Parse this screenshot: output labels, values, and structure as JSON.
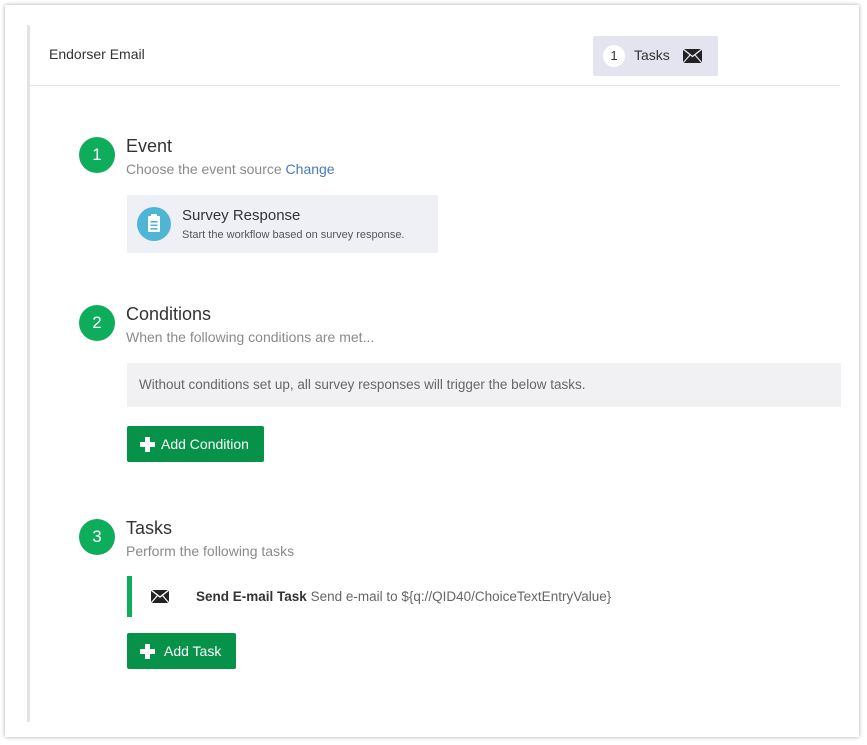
{
  "header": {
    "title": "Endorser Email",
    "tasks_count": "1",
    "tasks_label": "Tasks",
    "tasks_icon": "envelope-icon"
  },
  "steps": [
    {
      "number": "1",
      "title": "Event",
      "subtitle": "Choose the event source",
      "link": "Change",
      "card": {
        "icon": "clipboard-icon",
        "title": "Survey Response",
        "subtitle": "Start the workflow based on survey response."
      }
    },
    {
      "number": "2",
      "title": "Conditions",
      "subtitle": "When the following conditions are met...",
      "notice": "Without conditions set up, all survey responses will trigger the below tasks.",
      "button": "Add Condition"
    },
    {
      "number": "3",
      "title": "Tasks",
      "subtitle": "Perform the following tasks",
      "task": {
        "icon": "envelope-icon",
        "name": "Send E-mail Task",
        "description": "Send e-mail to ${q://QID40/ChoiceTextEntryValue}"
      },
      "button": "Add Task"
    }
  ],
  "colors": {
    "step_green": "#0ead5c",
    "button_green": "#07924a",
    "link_blue": "#4a78b8",
    "survey_icon_blue": "#4fb5d4"
  }
}
